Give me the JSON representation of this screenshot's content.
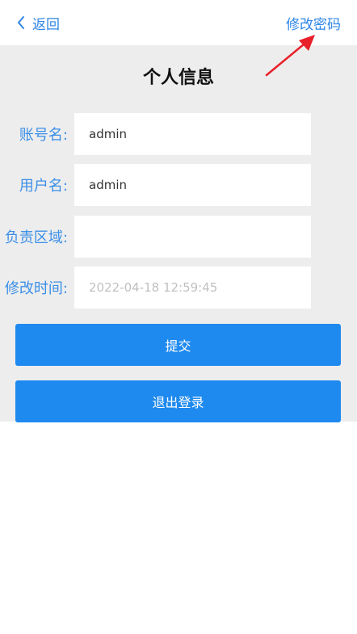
{
  "header": {
    "back_label": "返回",
    "change_password_label": "修改密码"
  },
  "panel": {
    "title": "个人信息"
  },
  "form": {
    "fields": [
      {
        "label": "账号名:",
        "value": "admin",
        "placeholder": ""
      },
      {
        "label": "用户名:",
        "value": "admin",
        "placeholder": ""
      },
      {
        "label": "负责区域:",
        "value": "",
        "placeholder": ""
      },
      {
        "label": "修改时间:",
        "value": "",
        "placeholder": "2022-04-18 12:59:45"
      }
    ]
  },
  "buttons": {
    "submit_label": "提交",
    "logout_label": "退出登录"
  },
  "colors": {
    "accent": "#2f86e6",
    "button": "#1e8aef",
    "panel_bg": "#ededed",
    "annotation_arrow": "#e8202a"
  },
  "icons": {
    "back": "chevron-left-icon",
    "annotation": "red-arrow-icon"
  }
}
